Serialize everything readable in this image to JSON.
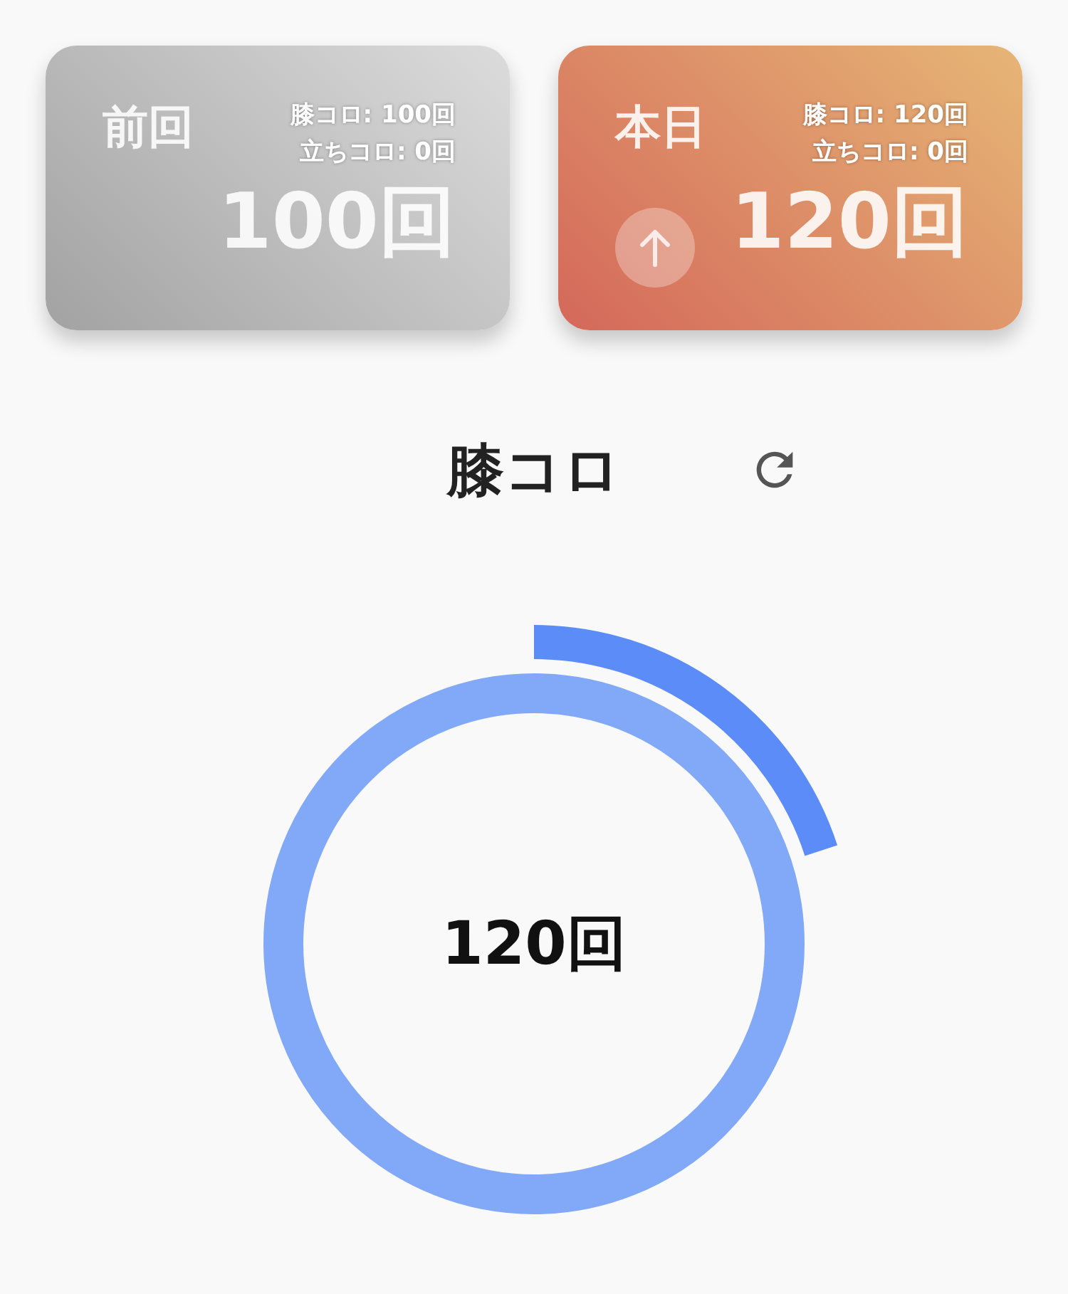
{
  "cards": [
    {
      "kind": "previous",
      "label": "前回",
      "details": [
        "膝コロ: 100回",
        "立ちコロ: 0回"
      ],
      "total": "100回",
      "trending_up": false
    },
    {
      "kind": "today",
      "label": "本日",
      "details": [
        "膝コロ: 120回",
        "立ちコロ: 0回"
      ],
      "total": "120回",
      "trending_up": true
    }
  ],
  "exercise": {
    "title": "膝コロ"
  },
  "ring": {
    "value": "120回"
  }
}
